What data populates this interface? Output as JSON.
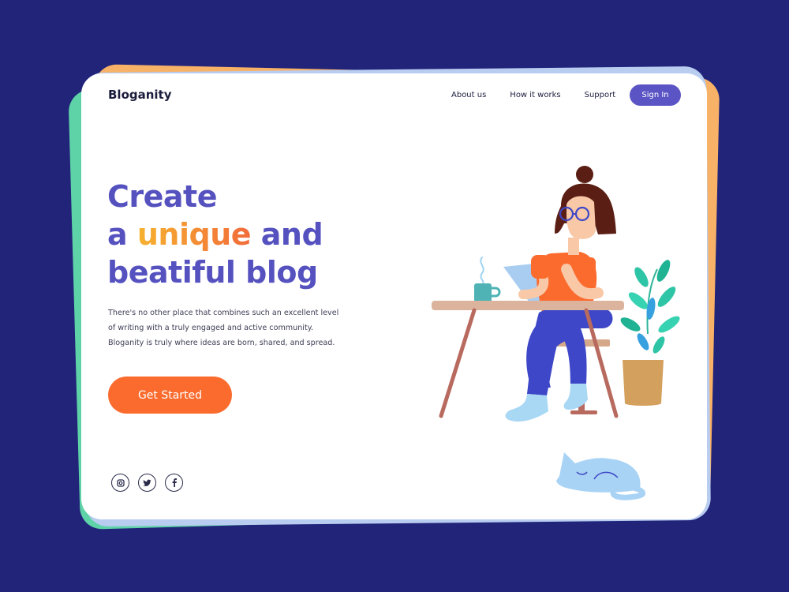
{
  "header": {
    "logo": "Bloganity",
    "nav": [
      "About us",
      "How it works",
      "Support"
    ],
    "signin_label": "Sign In"
  },
  "hero": {
    "headline_line1": "Create",
    "headline_line2_pre": "a ",
    "headline_highlight": "unique",
    "headline_line2_post": " and",
    "headline_line3": "beatiful blog",
    "description": "There's no other place that combines such an excellent level of writing with a truly engaged and active community. Bloganity is truly where ideas are born, shared, and spread.",
    "cta_label": "Get Started"
  },
  "socials": [
    {
      "icon": "instagram-icon"
    },
    {
      "icon": "twitter-icon"
    },
    {
      "icon": "facebook-icon"
    }
  ],
  "colors": {
    "background": "#22247a",
    "brand": "#5b54c4",
    "accent": "#fb6b2e",
    "highlight_from": "#f6b22f",
    "highlight_to": "#f26b3a"
  }
}
